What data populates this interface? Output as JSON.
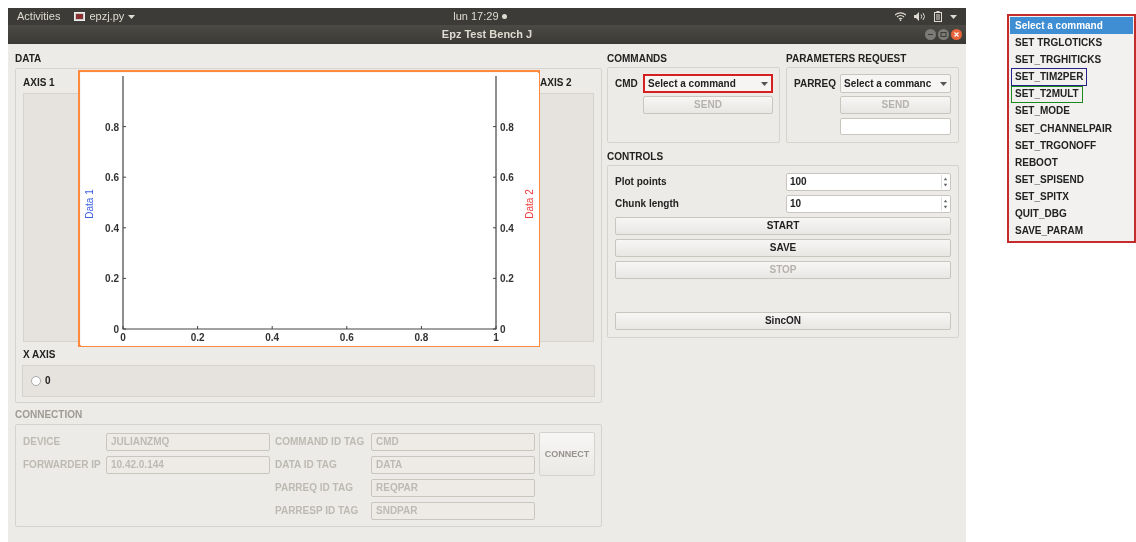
{
  "top_bar": {
    "activities": "Activities",
    "app_menu": "epzj.py",
    "clock": "lun 17:29"
  },
  "window": {
    "title": "Epz Test Bench J"
  },
  "data_section": {
    "title": "DATA",
    "axis1_label": "AXIS 1",
    "axis2_label": "AXIS 2",
    "plot": {
      "color": "#ff8a3d",
      "left_axis": {
        "title": "Data 1",
        "color": "#3a5fe0",
        "ticks": [
          "0.8",
          "0.6",
          "0.4",
          "0.2",
          "0"
        ]
      },
      "right_axis": {
        "title": "Data 2",
        "color": "#ee3a3a",
        "ticks": [
          "0.8",
          "0.6",
          "0.4",
          "0.2",
          "0"
        ]
      },
      "bottom_axis": {
        "ticks": [
          "0",
          "0.2",
          "0.4",
          "0.6",
          "0.8",
          "1"
        ]
      }
    },
    "x_axis": {
      "title": "X AXIS",
      "options": [
        {
          "label": "0",
          "selected": false
        }
      ]
    }
  },
  "commands": {
    "title": "COMMANDS",
    "label": "CMD",
    "select": {
      "value": "Select a command",
      "color": "#d42020"
    },
    "send": {
      "label": "SEND",
      "disabled": true
    }
  },
  "parameters_request": {
    "title": "PARAMETERS REQUEST",
    "label": "PARREQ",
    "select": {
      "value": "Select a commanc"
    },
    "send": {
      "label": "SEND",
      "disabled": true
    }
  },
  "controls": {
    "title": "CONTROLS",
    "fields": [
      {
        "label": "Plot points",
        "value": "100"
      },
      {
        "label": "Chunk length",
        "value": "10"
      }
    ],
    "buttons": [
      {
        "label": "START",
        "disabled": false
      },
      {
        "label": "SAVE",
        "disabled": false
      },
      {
        "label": "STOP",
        "disabled": true
      }
    ],
    "bottom_buttons": [
      {
        "label": "SincON",
        "disabled": false
      }
    ]
  },
  "connection": {
    "title": "CONNECTION",
    "disabled": true,
    "left_fields": [
      {
        "label": "DEVICE",
        "value": "JULIANZMQ"
      },
      {
        "label": "FORWARDER IP",
        "value": "10.42.0.144"
      }
    ],
    "right_fields": [
      {
        "label": "COMMAND ID TAG",
        "value": "CMD"
      },
      {
        "label": "DATA ID TAG",
        "value": "DATA"
      },
      {
        "label": "PARREQ ID TAG",
        "value": "REQPAR"
      },
      {
        "label": "PARRESP ID TAG",
        "value": "SNDPAR"
      }
    ],
    "connect": "CONNECT"
  },
  "dropdown": {
    "color": "#c42b2b",
    "items": [
      {
        "label": "Select a command",
        "selected": true
      },
      {
        "label": "SET TRGLOTICKS",
        "selected": false
      },
      {
        "label": "SET_TRGHITICKS",
        "selected": false
      },
      {
        "label": "SET_TIM2PER",
        "selected": false,
        "color": "#232388"
      },
      {
        "label": "SET_T2MULT",
        "selected": false,
        "color": "#1c8a1c"
      },
      {
        "label": "SET_MODE",
        "selected": false
      },
      {
        "label": "SET_CHANNELPAIR",
        "selected": false
      },
      {
        "label": "SET_TRGONOFF",
        "selected": false
      },
      {
        "label": "REBOOT",
        "selected": false
      },
      {
        "label": "SET_SPISEND",
        "selected": false
      },
      {
        "label": "SET_SPITX",
        "selected": false
      },
      {
        "label": "QUIT_DBG",
        "selected": false
      },
      {
        "label": "SAVE_PARAM",
        "selected": false
      }
    ]
  }
}
